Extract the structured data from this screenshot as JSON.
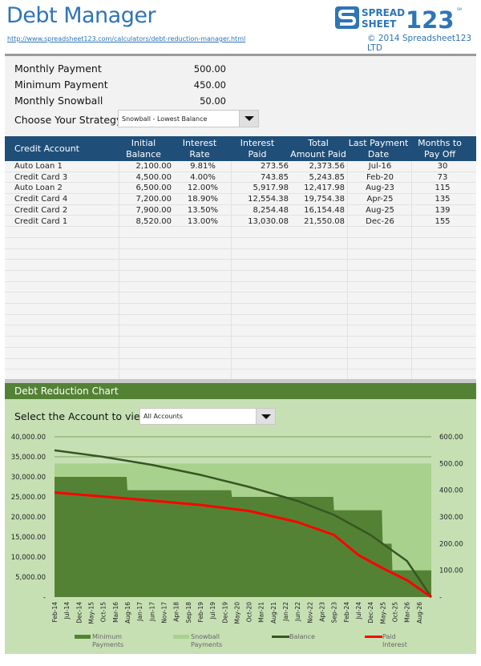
{
  "header": {
    "title": "Debt Manager",
    "url": "http://www.spreadsheet123.com/calculators/debt-reduction-manager.html",
    "copyright": "© 2014 Spreadsheet123 LTD",
    "logo": {
      "top": "SPREAD",
      "bottom": "SHEET",
      "num": "123",
      "tm": "SM"
    }
  },
  "inputs": {
    "monthly_payment": {
      "label": "Monthly Payment",
      "value": "500.00"
    },
    "minimum_payment": {
      "label": "Minimum Payment",
      "value": "450.00"
    },
    "monthly_snowball": {
      "label": "Monthly Snowball",
      "value": "50.00"
    },
    "strategy": {
      "label": "Choose Your Strategy",
      "value": "Snowball - Lowest Balance"
    }
  },
  "table": {
    "headers": [
      {
        "l1": "Credit Account",
        "l2": ""
      },
      {
        "l1": "Initial",
        "l2": "Balance"
      },
      {
        "l1": "Interest",
        "l2": "Rate"
      },
      {
        "l1": "Interest",
        "l2": "Paid"
      },
      {
        "l1": "Total",
        "l2": "Amount Paid"
      },
      {
        "l1": "Last Payment",
        "l2": "Date"
      },
      {
        "l1": "Months to",
        "l2": "Pay Off"
      }
    ],
    "rows": [
      [
        "Auto Loan 1",
        "2,100.00",
        "9.81%",
        "273.56",
        "2,373.56",
        "Jul-16",
        "30"
      ],
      [
        "Credit Card 3",
        "4,500.00",
        "4.00%",
        "743.85",
        "5,243.85",
        "Feb-20",
        "73"
      ],
      [
        "Auto Loan 2",
        "6,500.00",
        "12.00%",
        "5,917.98",
        "12,417.98",
        "Aug-23",
        "115"
      ],
      [
        "Credit Card 4",
        "7,200.00",
        "18.90%",
        "12,554.38",
        "19,754.38",
        "Apr-25",
        "135"
      ],
      [
        "Credit Card 2",
        "7,900.00",
        "13.50%",
        "8,254.48",
        "16,154.48",
        "Aug-25",
        "139"
      ],
      [
        "Credit Card 1",
        "8,520.00",
        "13.00%",
        "13,030.08",
        "21,550.08",
        "Dec-26",
        "155"
      ]
    ]
  },
  "chart_section": {
    "title": "Debt Reduction Chart",
    "account_label": "Select the Account to view",
    "account_value": "All Accounts"
  },
  "chart_data": {
    "type": "area",
    "title": "Debt Reduction Chart",
    "x_labels": [
      "Feb-14",
      "Jul-14",
      "Dec-14",
      "May-15",
      "Oct-15",
      "Mar-16",
      "Aug-16",
      "Jan-17",
      "Jun-17",
      "Nov-17",
      "Apr-18",
      "Sep-18",
      "Feb-19",
      "Jul-19",
      "Dec-19",
      "May-20",
      "Oct-20",
      "Mar-21",
      "Aug-21",
      "Jan-22",
      "Jun-22",
      "Nov-22",
      "Apr-23",
      "Sep-23",
      "Feb-24",
      "Jul-24",
      "Dec-24",
      "May-25",
      "Oct-25",
      "Mar-26",
      "Aug-26"
    ],
    "months_total": 155,
    "left_axis": {
      "ticks": [
        "-",
        "5,000.00",
        "10,000.00",
        "15,000.00",
        "20,000.00",
        "25,000.00",
        "30,000.00",
        "35,000.00",
        "40,000.00"
      ],
      "range": [
        0,
        40000
      ]
    },
    "right_axis": {
      "ticks": [
        "-",
        "100.00",
        "200.00",
        "300.00",
        "400.00",
        "500.00",
        "600.00"
      ],
      "range": [
        0,
        600
      ]
    },
    "series": [
      {
        "name": "Minimum Payments",
        "axis": "right",
        "kind": "stacked-area",
        "color": "#548235",
        "steps": [
          [
            0,
            450
          ],
          [
            30,
            400
          ],
          [
            73,
            375
          ],
          [
            115,
            325
          ],
          [
            135,
            200
          ],
          [
            139,
            100
          ],
          [
            155,
            100
          ]
        ]
      },
      {
        "name": "Snowball Payments",
        "axis": "right",
        "kind": "stacked-area",
        "color": "#a9d18e",
        "total": 500
      },
      {
        "name": "Balance",
        "axis": "left",
        "kind": "line",
        "color": "#375623",
        "points": [
          [
            0,
            36620
          ],
          [
            20,
            35000
          ],
          [
            40,
            33000
          ],
          [
            60,
            30500
          ],
          [
            80,
            27500
          ],
          [
            100,
            24000
          ],
          [
            115,
            20500
          ],
          [
            130,
            15500
          ],
          [
            145,
            9000
          ],
          [
            155,
            0
          ]
        ]
      },
      {
        "name": "Paid Interest",
        "axis": "left",
        "kind": "line",
        "color": "#ff0000",
        "points": [
          [
            0,
            26100
          ],
          [
            30,
            24600
          ],
          [
            60,
            23000
          ],
          [
            80,
            21500
          ],
          [
            100,
            18700
          ],
          [
            115,
            15500
          ],
          [
            125,
            10500
          ],
          [
            135,
            7200
          ],
          [
            145,
            4200
          ],
          [
            155,
            0
          ]
        ]
      }
    ],
    "legend": [
      {
        "l1": "Minimum",
        "l2": "Payments",
        "color": "#548235",
        "style": "box"
      },
      {
        "l1": "Snowball",
        "l2": "Payments",
        "color": "#a9d18e",
        "style": "box"
      },
      {
        "l1": "Balance",
        "l2": "",
        "color": "#375623",
        "style": "line"
      },
      {
        "l1": "Paid",
        "l2": "Interest",
        "color": "#ff0000",
        "style": "line"
      }
    ],
    "legend_position": "bottom",
    "grid": true
  }
}
